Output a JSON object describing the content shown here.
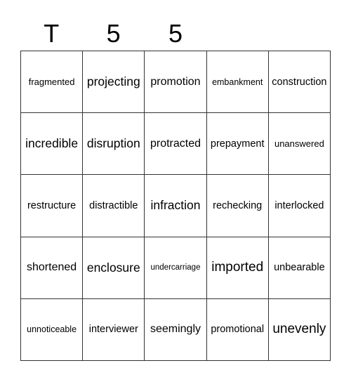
{
  "header": {
    "letters": [
      "T",
      "5",
      "5",
      "",
      ""
    ]
  },
  "grid": {
    "rows": [
      [
        "fragmented",
        "projecting",
        "promotion",
        "embankment",
        "construction"
      ],
      [
        "incredible",
        "disruption",
        "protracted",
        "prepayment",
        "unanswered"
      ],
      [
        "restructure",
        "distractible",
        "infraction",
        "rechecking",
        "interlocked"
      ],
      [
        "shortened",
        "enclosure",
        "undercarriage",
        "imported",
        "unbearable"
      ],
      [
        "unnoticeable",
        "interviewer",
        "seemingly",
        "promotional",
        "unevenly"
      ]
    ]
  }
}
